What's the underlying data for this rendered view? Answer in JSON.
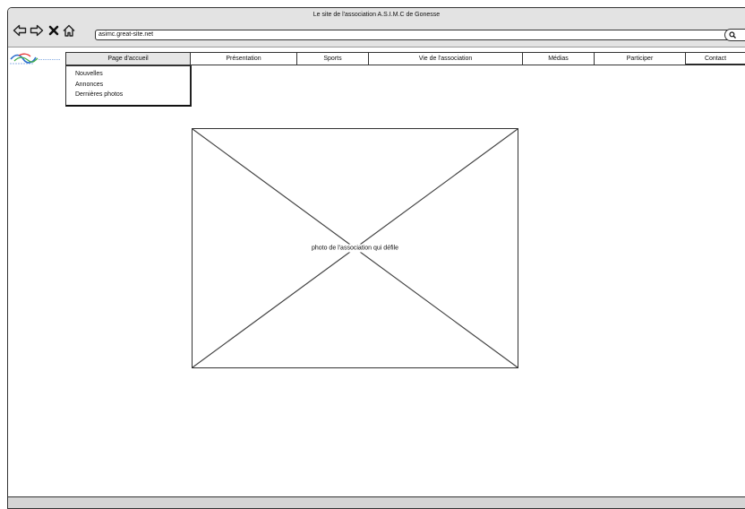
{
  "window": {
    "title": "Le site de l'association A.S.I.M.C de Gonesse"
  },
  "toolbar": {
    "back_icon": "back-arrow-icon",
    "forward_icon": "forward-arrow-icon",
    "stop_icon": "close-icon",
    "home_icon": "home-icon",
    "url": "asimc.great-site.net",
    "search_icon": "search-icon"
  },
  "logo": {
    "name": "asimc-logo",
    "colors": [
      "#2c6fcf",
      "#3fae49",
      "#e83c3c"
    ]
  },
  "menu": {
    "items": [
      {
        "label": "Page d'accueil",
        "active": true
      },
      {
        "label": "Présentation"
      },
      {
        "label": "Sports"
      },
      {
        "label": "Vie de l'association"
      },
      {
        "label": "Médias"
      },
      {
        "label": "Participer"
      },
      {
        "label": "Contact"
      }
    ]
  },
  "dropdown": {
    "items": [
      {
        "label": "Nouvelles"
      },
      {
        "label": "Annonces"
      },
      {
        "label": "Dernières photos"
      }
    ]
  },
  "main": {
    "image_caption": "photo de l'association qui défile"
  },
  "colors": {
    "chrome": "#e3e3e3",
    "border": "#333333",
    "active_menu": "#e6e6e6",
    "status_bar": "#d5d5d5"
  }
}
